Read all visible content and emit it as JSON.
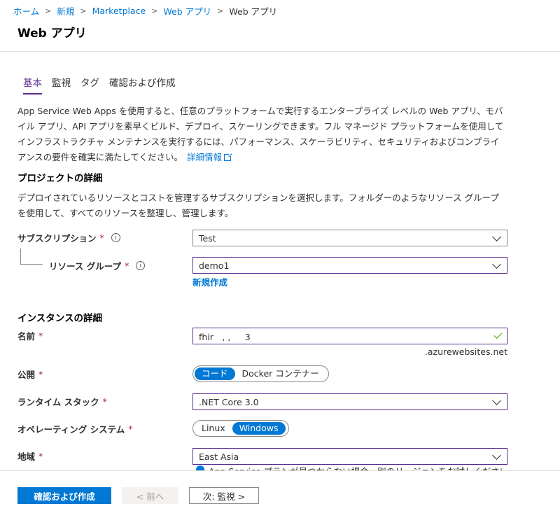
{
  "breadcrumb": [
    "ホーム",
    "新規",
    "Marketplace",
    "Web アプリ",
    "Web アプリ"
  ],
  "page_title": "Web アプリ",
  "tabs": [
    {
      "label": "基本",
      "active": true
    },
    {
      "label": "監視",
      "active": false
    },
    {
      "label": "タグ",
      "active": false
    },
    {
      "label": "確認および作成",
      "active": false
    }
  ],
  "intro": {
    "text": "App Service Web Apps を使用すると、任意のプラットフォームで実行するエンタープライズ レベルの Web アプリ、モバイル アプリ、API アプリを素早くビルド、デプロイ、スケーリングできます。フル マネージド プラットフォームを使用してインフラストラクチャ メンテナンスを実行するには、パフォーマンス、スケーラビリティ、セキュリティおよびコンプライアンスの要件を確実に満たしてください。",
    "link": "詳細情報"
  },
  "project": {
    "title": "プロジェクトの詳細",
    "desc": "デプロイされているリソースとコストを管理するサブスクリプションを選択します。フォルダーのようなリソース グループを使用して、すべてのリソースを整理し、管理します。",
    "subscription_label": "サブスクリプション",
    "subscription_value": "Test",
    "rg_label": "リソース グループ",
    "rg_value": "demo1",
    "new_link": "新規作成"
  },
  "instance": {
    "title": "インスタンスの詳細",
    "name_label": "名前",
    "name_value": "fhir　, ,　  3",
    "name_suffix": ".azurewebsites.net",
    "publish_label": "公開",
    "publish_options": [
      "コード",
      "Docker コンテナー"
    ],
    "publish_selected": "コード",
    "runtime_label": "ランタイム スタック",
    "runtime_value": ".NET Core 3.0",
    "os_label": "オペレーティング システム",
    "os_options": [
      "Linux",
      "Windows"
    ],
    "os_selected": "Windows",
    "region_label": "地域",
    "region_value": "East Asia",
    "region_notice": "App Service プランが見つからない場合、別のリージョンをお試しください"
  },
  "required_mark": "*",
  "info_glyph": "i",
  "footer": {
    "review_create": "確認および作成",
    "prev": "< 前へ",
    "next": "次: 監視 >"
  },
  "colors": {
    "link": "#0078d4",
    "accent_purple": "#5c2d91",
    "required": "#a4262c",
    "valid_check": "#57a300"
  }
}
